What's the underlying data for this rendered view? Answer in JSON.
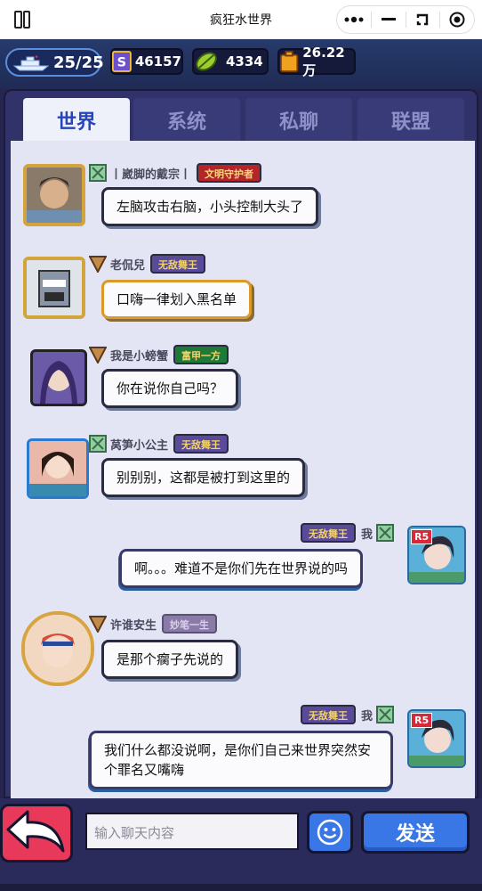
{
  "window": {
    "title": "疯狂水世界"
  },
  "resources": {
    "energy": "25/25",
    "item_s": "46157",
    "leaf": "4334",
    "gold": "26.22万"
  },
  "tabs": [
    {
      "label": "世界",
      "active": true
    },
    {
      "label": "系统",
      "active": false
    },
    {
      "label": "私聊",
      "active": false
    },
    {
      "label": "联盟",
      "active": false
    }
  ],
  "messages": [
    {
      "name": "丨崴脚的戴宗丨",
      "badge": "文明守护者",
      "text": "左脑攻击右脑，小头控制大头了",
      "self": false
    },
    {
      "name": "老侃兒",
      "badge": "无敌舞王",
      "text": "口嗨一律划入黑名单",
      "self": false
    },
    {
      "name": "我是小螃蟹",
      "badge": "富甲一方",
      "text": "你在说你自己吗？",
      "self": false
    },
    {
      "name": "莴笋小公主",
      "badge": "无敌舞王",
      "text": "别别别，这都是被打到这里的",
      "self": false
    },
    {
      "name": "我",
      "badge": "无敌舞王",
      "avatar_tag": "R5",
      "text": "啊。。。难道不是你们先在世界说的吗",
      "self": true
    },
    {
      "name": "许谁安生",
      "badge": "妙笔一生",
      "text": "是那个瘸子先说的",
      "self": false
    },
    {
      "name": "我",
      "badge": "无敌舞王",
      "avatar_tag": "R5",
      "text": "我们什么都没说啊，是你们自己来世界突然安个罪名又嘴嗨",
      "self": true
    }
  ],
  "input": {
    "placeholder": "输入聊天内容"
  },
  "send_label": "发送",
  "colors": {
    "accent": "#3a77e6",
    "back": "#e8395b",
    "panel": "#31326a",
    "chat_bg": "#e3e5f5"
  }
}
